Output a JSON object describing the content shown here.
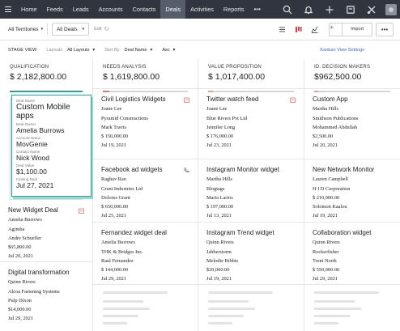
{
  "nav": {
    "items": [
      "Home",
      "Feeds",
      "Leads",
      "Accounts",
      "Contacts",
      "Deals",
      "Activities",
      "Reports"
    ],
    "active": "Deals",
    "more": "•••"
  },
  "toolbar": {
    "territory": "All Territories",
    "view": "All Deals",
    "edit": "Edit",
    "import": "Import",
    "more": "•••"
  },
  "subbar": {
    "title": "STAGE VIEW",
    "layouts_label": "Layouts",
    "layouts_value": "All Layouts",
    "sort_label": "Sort By",
    "sort_value": "Deal Name",
    "order_value": "Asc",
    "kanban_link": "Kanban View Settings"
  },
  "columns": [
    {
      "name": "QUALIFICATION",
      "amount": "$ 2,182,800.00",
      "color": "#26a69a",
      "fill": 1.0,
      "cards": [
        {
          "title": "New Widget Deal",
          "lines": [
            "Amelia Burrows",
            "Agimba",
            "Andre Schueller",
            "$65,800.00",
            "Jul 20, 2021"
          ]
        },
        {
          "title": "Digital transformation",
          "lines": [
            "Quinn Rivers",
            "Alcoa Fastening Systems",
            "Pulp Dixon",
            "$14,000.00",
            "Jul 29, 2021"
          ]
        }
      ]
    },
    {
      "name": "NEEDS ANALYSIS",
      "amount": "$ 1,619,800.00",
      "color": "#e57373",
      "fill": 0.08,
      "cards": [
        {
          "title": "Civil Logistics Widgets",
          "lines": [
            "Joane Lee",
            "Pyramid Constructions",
            "Mark Travis",
            "$ 150,000.00",
            "Jul 19, 2021"
          ]
        },
        {
          "title": "Facebook ad widgets",
          "lines": [
            "Raghav Rao",
            "Grant Industries Ltd",
            "Dolores Grant",
            "$ 650,000.00",
            "Jul 25, 2021"
          ]
        },
        {
          "title": "Fernandez widget deal",
          "lines": [
            "Amelia Burrows",
            "THK & Bridges Inc.",
            "Raul Fernandez",
            "$ 144,000.00",
            "Jul 29, 2021"
          ]
        }
      ]
    },
    {
      "name": "VALUE PROPOSITION",
      "amount": "$ 1,017,400.00",
      "color": "#ef9a9a",
      "fill": 0.06,
      "cards": [
        {
          "title": "Twitter watch feed",
          "lines": [
            "Joane Lee",
            "Blue Rivers Pvt Ltd",
            "Jennifer Long",
            "$ 176,000.00",
            "Jul 23, 2021"
          ]
        },
        {
          "title": "Instagram Monitor widget",
          "lines": [
            "Martha Hills",
            "Blogtags",
            "Maria Larios",
            "$ 197,000.00",
            "Jul 13, 2021"
          ]
        },
        {
          "title": "Instagram Trend widget",
          "lines": [
            "Quinn Rivers",
            "Jabberstorm",
            "Melodie Bibbie",
            "$20,000.00",
            "Jul 19, 2021"
          ]
        }
      ]
    },
    {
      "name": "ID. DECISION MAKERS",
      "amount": "$962,500.00",
      "color": "#ef9a9a",
      "fill": 0.05,
      "cards": [
        {
          "title": "Custom App",
          "lines": [
            "Martha Hills",
            "Smithson Publications",
            "Mohammed Abdullah",
            "$2,500.00",
            "Jul 20, 2021"
          ]
        },
        {
          "title": "New Network Monitor",
          "lines": [
            "Lauren Campbell",
            "H I D Corporation",
            "$ 210,000.00",
            "Solomon Kaalou",
            "Jul 19, 2021"
          ]
        },
        {
          "title": "Collaboration widget",
          "lines": [
            "Quinn Rivers",
            "Rockerfisher",
            "Trent North",
            "$ 550,000.00",
            "Jul 29, 2021"
          ]
        }
      ]
    }
  ],
  "popup": {
    "deal_name_label": "Deal Name",
    "deal_name": "Custom Mobile apps",
    "owner_label": "Deal Owner",
    "owner": "Amelia Burrows",
    "account_label": "Account Name",
    "account": "MovGenie",
    "contact_label": "Contact Name",
    "contact": "Nick Wood",
    "value_label": "Deal Value",
    "value": "$1,100.00",
    "closing_label": "Closing Date",
    "closing": "Jul 27, 2021"
  }
}
